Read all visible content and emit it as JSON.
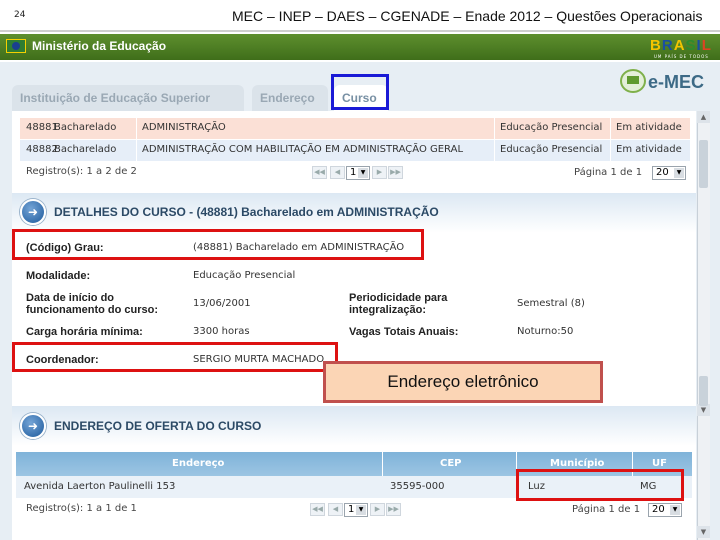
{
  "slide": {
    "number": "24",
    "title": "MEC – INEP – DAES – CGENADE – Enade 2012 – Questões Operacionais"
  },
  "gov_bar": {
    "ministry_label": "Ministério da Educação",
    "brasil_logo": "BRASIL",
    "brasil_slogan": "UM PAÍS DE TODOS"
  },
  "tabs": [
    {
      "label": "Instituição de Educação Superior",
      "active": false
    },
    {
      "label": "Endereço",
      "active": false
    },
    {
      "label": "Curso",
      "active": true
    }
  ],
  "logo": {
    "text": "e-MEC"
  },
  "courses_table": {
    "rows": [
      {
        "code": "48881",
        "grau": "Bacharelado",
        "nome": "ADMINISTRAÇÃO",
        "modalidade": "Educação Presencial",
        "situacao": "Em atividade"
      },
      {
        "code": "48882",
        "grau": "Bacharelado",
        "nome": "ADMINISTRAÇÃO COM HABILITAÇÃO EM ADMINISTRAÇÃO GERAL",
        "modalidade": "Educação Presencial",
        "situacao": "Em atividade"
      }
    ],
    "pager": {
      "registros": "Registro(s): 1 a 2 de 2",
      "page_select": "1",
      "pagina": "Página 1 de 1",
      "page_size": "20"
    }
  },
  "detalhes": {
    "title": "DETALHES DO CURSO - (48881) Bacharelado em ADMINISTRAÇÃO",
    "codigo_grau_label": "(Código) Grau:",
    "codigo_grau_value": "(48881) Bacharelado em ADMINISTRAÇÃO",
    "modalidade_label": "Modalidade:",
    "modalidade_value": "Educação Presencial",
    "data_inicio_label_1": "Data de início do",
    "data_inicio_label_2": "funcionamento do curso:",
    "data_inicio_value": "13/06/2001",
    "periodicidade_label_1": "Periodicidade para",
    "periodicidade_label_2": "integralização:",
    "periodicidade_value": "Semestral (8)",
    "carga_label": "Carga horária mínima:",
    "carga_value": "3300 horas",
    "vagas_label": "Vagas Totais Anuais:",
    "vagas_value": "Noturno:50",
    "coordenador_label": "Coordenador:",
    "coordenador_value": "SERGIO MURTA MACHADO"
  },
  "callout": {
    "text": "Endereço eletrônico"
  },
  "endereco_oferta": {
    "title": "ENDEREÇO DE OFERTA DO CURSO",
    "headers": {
      "endereco": "Endereço",
      "cep": "CEP",
      "municipio": "Município",
      "uf": "UF"
    },
    "row": {
      "endereco": "Avenida Laerton Paulinelli 153",
      "cep": "35595-000",
      "municipio": "Luz",
      "uf": "MG"
    },
    "pager": {
      "registros": "Registro(s): 1 a 1 de 1",
      "page_select": "1",
      "pagina": "Página 1 de 1",
      "page_size": "20"
    }
  },
  "colors": {
    "gov_green": "#4a7a22",
    "highlight_red": "#dd1111",
    "active_tab_outline": "#1a1ad6",
    "callout_fill": "#fbd5b5",
    "section_title": "#2c4a66"
  }
}
